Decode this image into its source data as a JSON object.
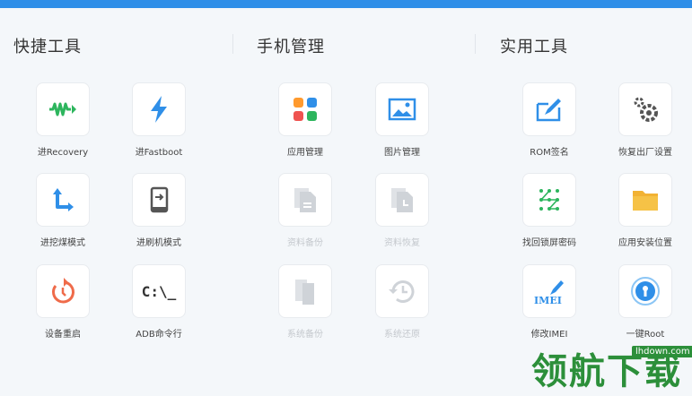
{
  "sections": {
    "quick": "快捷工具",
    "phone": "手机管理",
    "utility": "实用工具"
  },
  "tiles": {
    "recovery": "进Recovery",
    "fastboot": "进Fastboot",
    "download": "进挖煤模式",
    "flash": "进刷机模式",
    "reboot": "设备重启",
    "adb": "ADB命令行",
    "adb_glyph": "C:\\_",
    "apps": "应用管理",
    "photos": "图片管理",
    "backup": "资料备份",
    "restore": "资料恢复",
    "sys_backup": "系统备份",
    "sys_restore": "系统还原",
    "rom_sign": "ROM签名",
    "factory_reset": "恢复出厂设置",
    "unlock_pattern": "找回锁屏密码",
    "install_location": "应用安装位置",
    "imei": "修改IMEI",
    "root": "一键Root",
    "imei_glyph": "IMEI"
  },
  "watermark": {
    "text": "领航下载",
    "url": "lhdown.com"
  },
  "colors": {
    "accent": "#2f8fe8",
    "green": "#2db55d",
    "blue": "#2f8fe8",
    "red": "#ef6b4a",
    "disabled": "#c4c8cd"
  }
}
